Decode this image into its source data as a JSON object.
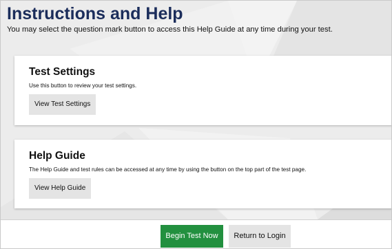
{
  "page": {
    "title": "Instructions and Help",
    "subtitle": "You may select the question mark button to access this Help Guide at any time during your test."
  },
  "test_settings": {
    "title": "Test Settings",
    "description": "Use this button to review your test settings.",
    "button_label": "View Test Settings"
  },
  "help_guide": {
    "title": "Help Guide",
    "description": "The Help Guide and test rules can be accessed at any time by using the button on the top part of the test page.",
    "button_label": "View Help Guide"
  },
  "footer": {
    "begin_label": "Begin Test Now",
    "return_label": "Return to Login"
  },
  "colors": {
    "title": "#1b2d5b",
    "begin_button": "#22903f",
    "grey_button": "#e4e4e4",
    "page_background": "#ececec"
  }
}
